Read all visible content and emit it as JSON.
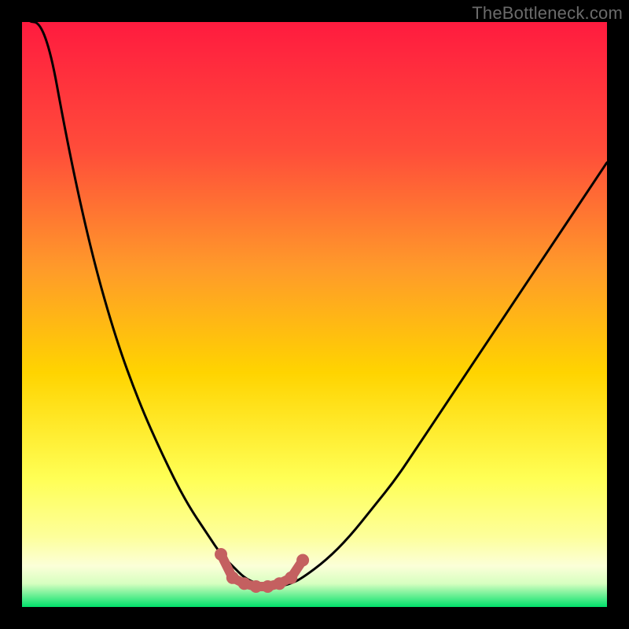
{
  "watermark": "TheBottleneck.com",
  "colors": {
    "frame": "#000000",
    "gradient_top": "#ff1b3f",
    "gradient_mid1": "#ff7a2a",
    "gradient_mid2": "#ffd400",
    "gradient_mid3": "#ffff66",
    "gradient_mid4": "#fffbc2",
    "gradient_bottom": "#00e06a",
    "curve": "#000000",
    "markers": "#c46060"
  },
  "chart_data": {
    "type": "line",
    "title": "",
    "xlabel": "",
    "ylabel": "",
    "xlim": [
      0,
      100
    ],
    "ylim": [
      0,
      100
    ],
    "x": [
      0,
      4,
      8,
      12,
      16,
      20,
      24,
      28,
      32,
      34,
      36,
      38,
      40,
      42,
      44,
      46,
      48,
      52,
      56,
      60,
      64,
      68,
      72,
      76,
      80,
      84,
      88,
      92,
      96,
      100
    ],
    "values": [
      125,
      100,
      78,
      60,
      46,
      35,
      26,
      18,
      12,
      9,
      7,
      5,
      4,
      3.5,
      3.5,
      4,
      5,
      8,
      12,
      17,
      22,
      28,
      34,
      40,
      46,
      52,
      58,
      64,
      70,
      76
    ],
    "markers": {
      "x": [
        34,
        36,
        38,
        40,
        42,
        44,
        46,
        48
      ],
      "y": [
        9,
        5,
        4,
        3.5,
        3.5,
        4,
        5,
        8
      ]
    },
    "annotations": []
  }
}
